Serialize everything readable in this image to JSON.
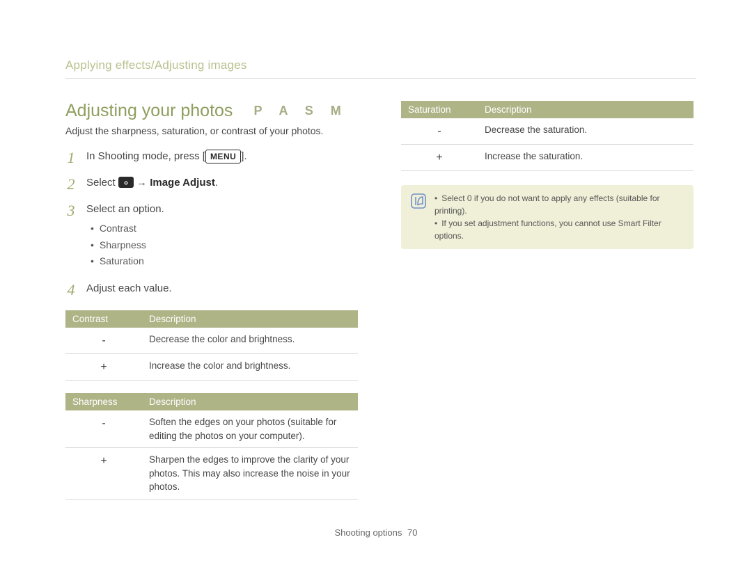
{
  "breadcrumb": "Applying effects/Adjusting images",
  "title": "Adjusting your photos",
  "modes": "P A S M",
  "subtitle": "Adjust the sharpness, saturation, or contrast of your photos.",
  "steps": {
    "s1_pre": "In Shooting mode, press [",
    "s1_menu": "MENU",
    "s1_post": "].",
    "s2_pre": "Select ",
    "s2_arrow": " → ",
    "s2_bold": "Image Adjust",
    "s2_post": ".",
    "s3": "Select an option.",
    "s4": "Adjust each value."
  },
  "options": {
    "a": "Contrast",
    "b": "Sharpness",
    "c": "Saturation"
  },
  "tables": {
    "contrast": {
      "h1": "Contrast",
      "h2": "Description",
      "rows": [
        {
          "k": "-",
          "v": "Decrease the color and brightness."
        },
        {
          "k": "+",
          "v": "Increase the color and brightness."
        }
      ]
    },
    "sharpness": {
      "h1": "Sharpness",
      "h2": "Description",
      "rows": [
        {
          "k": "-",
          "v": "Soften the edges on your photos (suitable for editing the photos on your computer)."
        },
        {
          "k": "+",
          "v": "Sharpen the edges to improve the clarity of your photos. This may also increase the noise in your photos."
        }
      ]
    },
    "saturation": {
      "h1": "Saturation",
      "h2": "Description",
      "rows": [
        {
          "k": "-",
          "v": "Decrease the saturation."
        },
        {
          "k": "+",
          "v": "Increase the saturation."
        }
      ]
    }
  },
  "note": {
    "a": "Select 0 if you do not want to apply any effects (suitable for printing).",
    "b": "If you set adjustment functions, you cannot use Smart Filter options."
  },
  "footer": {
    "section": "Shooting options",
    "page": "70"
  }
}
